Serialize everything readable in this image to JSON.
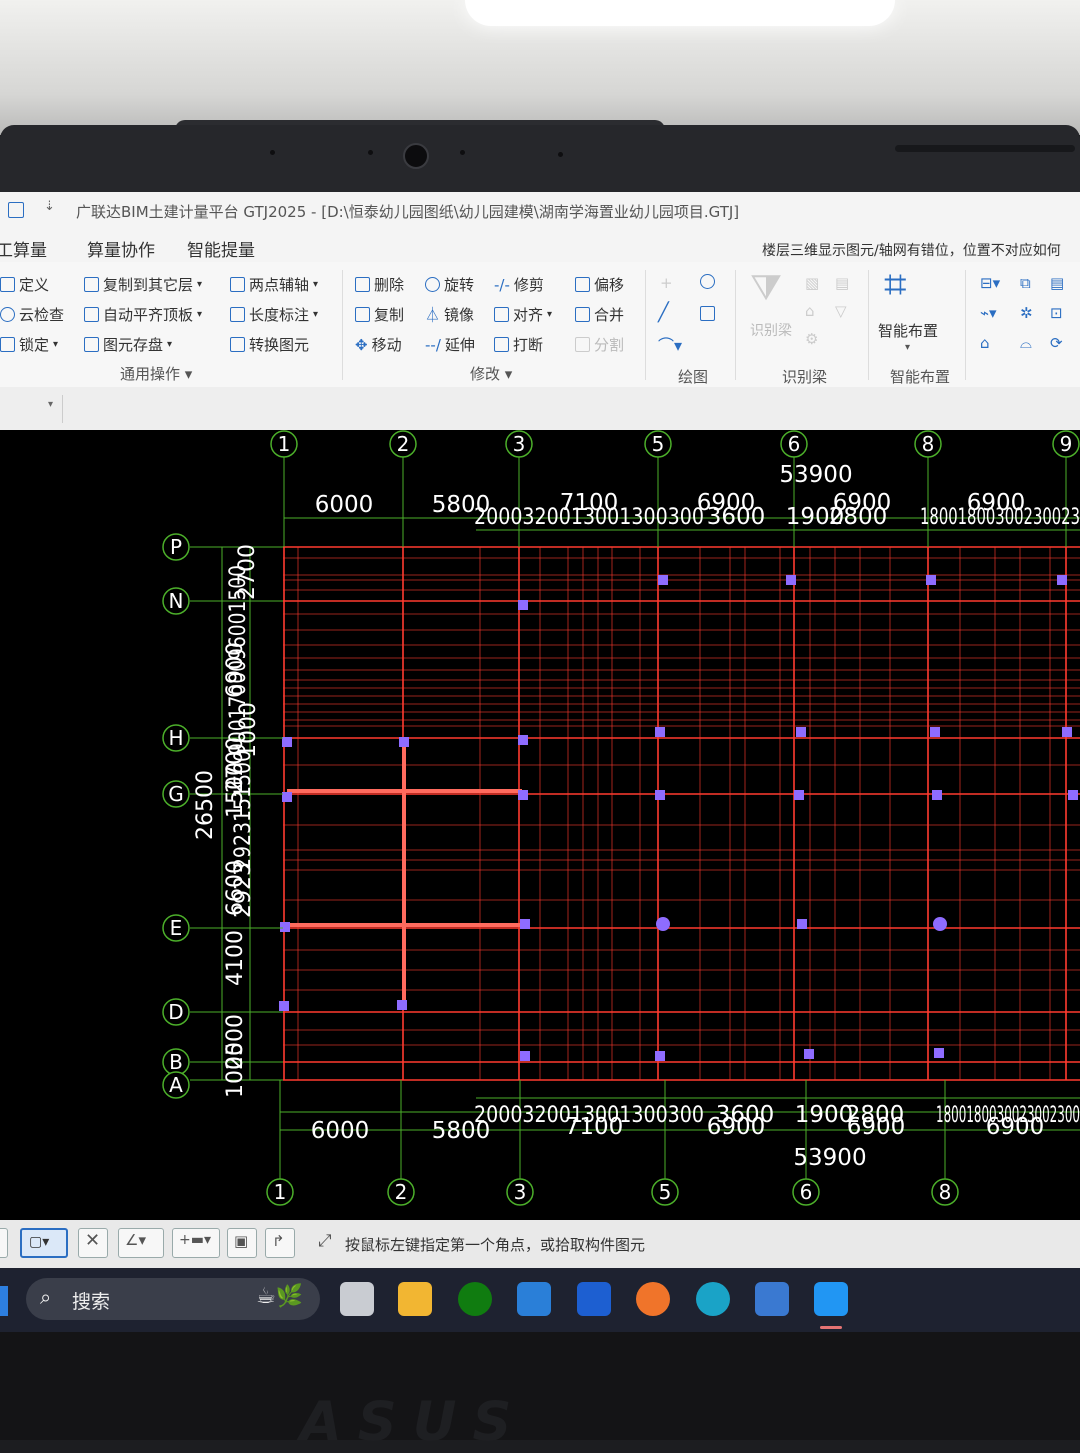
{
  "window": {
    "title": "广联达BIM土建计量平台 GTJ2025 - [D:\\恒泰幼儿园图纸\\幼儿园建模\\湖南学海置业幼儿园项目.GTJ]"
  },
  "menu": {
    "items": [
      "工算量",
      "算量协作",
      "智能提量"
    ],
    "notice": "楼层三维显示图元/轴网有错位，位置不对应如何"
  },
  "ribbon": {
    "general": [
      "定义",
      "云检查",
      "锁定",
      "复制到其它层",
      "自动平齐顶板",
      "图元存盘",
      "两点辅轴",
      "长度标注",
      "转换图元"
    ],
    "general_group": "通用操作",
    "modify": [
      "删除",
      "复制",
      "移动",
      "旋转",
      "镜像",
      "延伸",
      "修剪",
      "对齐",
      "打断",
      "偏移",
      "合并",
      "分割"
    ],
    "modify_group": "修改",
    "draw_group": "绘图",
    "identify_beam": "识别梁",
    "identify_group": "识别梁",
    "smart_layout": "智能布置",
    "smart_group": "智能布置"
  },
  "status": {
    "hint": "按鼠标左键指定第一个角点，或拾取构件图元"
  },
  "taskbar": {
    "search": "搜索"
  },
  "axes": {
    "top_axes": [
      "1",
      "2",
      "3",
      "5",
      "6",
      "8",
      "9"
    ],
    "bottom_axes": [
      "1",
      "2",
      "3",
      "5",
      "6",
      "8"
    ],
    "row_axes": [
      "P",
      "N",
      "H",
      "G",
      "E",
      "D",
      "B",
      "A"
    ],
    "total_x": "53900",
    "top_dims": [
      "6000",
      "5800",
      "2000320013001300300",
      "7100",
      "6900",
      "3600",
      "1900",
      "2800",
      "6900",
      "18001800300230023",
      "6900"
    ],
    "bottom_dims": [
      "6000",
      "5800",
      "2000320013001300300",
      "7100",
      "3600",
      "6900",
      "1900",
      "2800",
      "6900",
      "1800180030023002300",
      "6900"
    ],
    "left_dims": [
      "2700",
      "6900",
      "1500",
      "2700",
      "6600",
      "26500",
      "4100",
      "2500",
      "1000"
    ],
    "left_stack": [
      "9001700096001500",
      "1000",
      "2923151500",
      "2923"
    ]
  },
  "colors": {
    "grid_red": "#ff3b2f",
    "axis_green": "#4caf2a",
    "column_purple": "#8e6cff",
    "dim_green": "#6bd04a"
  },
  "brand": "ASUS"
}
